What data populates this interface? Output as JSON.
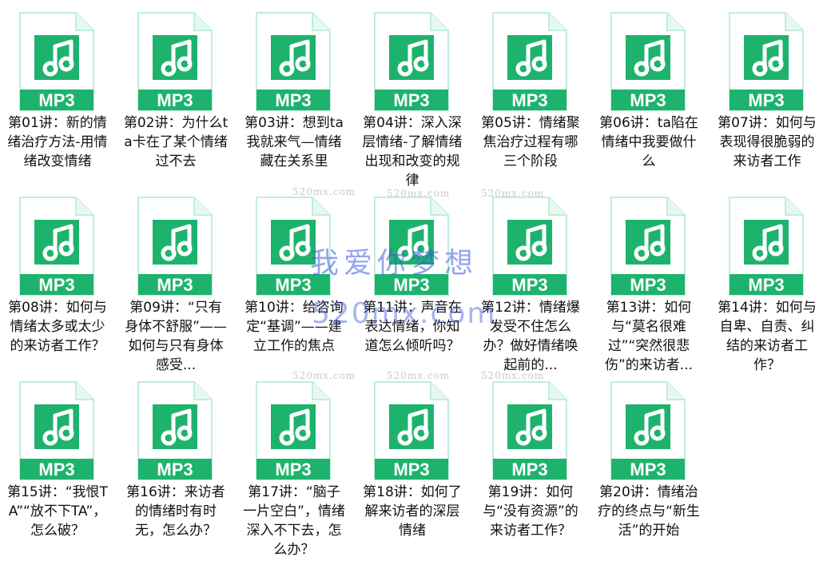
{
  "colors": {
    "icon_green": "#1db36d",
    "icon_outline": "#bfeede",
    "icon_fold": "#e8f8f1",
    "watermark_blue": "#3c5adc"
  },
  "icon": {
    "badge_text": "MP3",
    "symbol": "music-note-icon"
  },
  "files": [
    {
      "name": "第01讲：新的情绪治疗方法-用情绪改变情绪"
    },
    {
      "name": "第02讲：为什么ta卡在了某个情绪过不去"
    },
    {
      "name": "第03讲：想到ta我就来气—情绪藏在关系里"
    },
    {
      "name": "第04讲：深入深层情绪-了解情绪出现和改变的规律"
    },
    {
      "name": "第05讲：情绪聚焦治疗过程有哪三个阶段"
    },
    {
      "name": "第06讲：ta陷在情绪中我要做什么"
    },
    {
      "name": "第07讲：如何与表现得很脆弱的来访者工作"
    },
    {
      "name": "第08讲：如何与情绪太多或太少的来访者工作？"
    },
    {
      "name": "第09讲：“只有身体不舒服”——如何与只有身体感受..."
    },
    {
      "name": "第10讲：给咨询定“基调”——建立工作的焦点"
    },
    {
      "name": "第11讲：声音在表达情绪，你知道怎么倾听吗？"
    },
    {
      "name": "第12讲：情绪爆发受不住怎么办？做好情绪唤起前的..."
    },
    {
      "name": "第13讲：如何与“莫名很难过”“突然很悲伤”的来访者..."
    },
    {
      "name": "第14讲：如何与自卑、自责、纠结的来访者工作？"
    },
    {
      "name": "第15讲：“我恨TA”“放不下TA”，怎么破？"
    },
    {
      "name": "第16讲：来访者的情绪时有时无，怎么办？"
    },
    {
      "name": "第17讲：“脑子一片空白”，情绪深入不下去，怎么办？"
    },
    {
      "name": "第18讲：如何了解来访者的深层情绪"
    },
    {
      "name": "第19讲：如何与“没有资源”的来访者工作？"
    },
    {
      "name": "第20讲：情绪治疗的终点与“新生活”的开始"
    }
  ],
  "watermark": {
    "small": "520mx.com",
    "big_text": "我爱你梦想",
    "big_url": "520mx.com"
  }
}
